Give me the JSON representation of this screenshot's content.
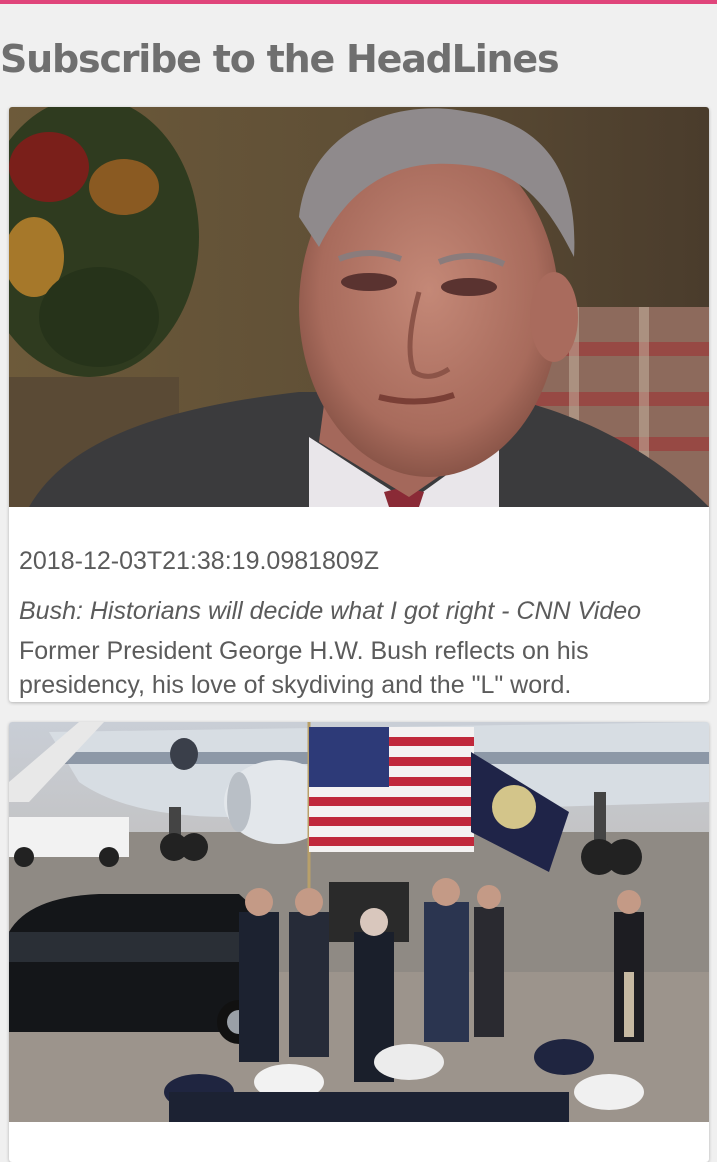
{
  "app": {
    "accent_color": "#e0457b",
    "title": "Subscribe to the HeadLines"
  },
  "articles": [
    {
      "timestamp": "2018-12-03T21:38:19.0981809Z",
      "headline": "Bush: Historians will decide what I got right - CNN Video",
      "summary": "Former President George H.W. Bush reflects on his presidency, his love of skydiving and the \"L\" word.",
      "image_subject": "interview-portrait-photo"
    },
    {
      "image_subject": "honor-guard-airport-ceremony-photo"
    }
  ]
}
